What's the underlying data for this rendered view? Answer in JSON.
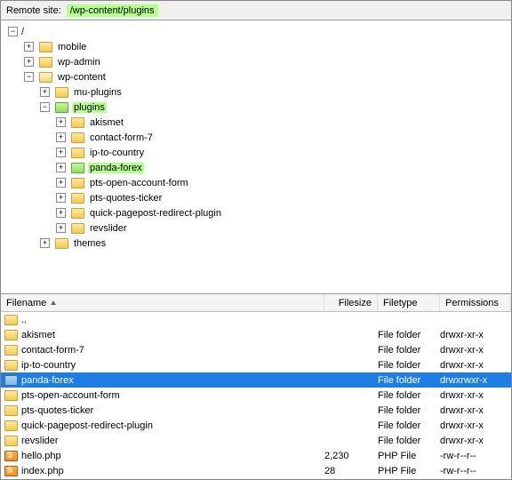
{
  "address_bar": {
    "label": "Remote site:",
    "path": "/wp-content/plugins"
  },
  "tree": [
    {
      "indent": 0,
      "tw": "c",
      "icon": "none",
      "label": "/"
    },
    {
      "indent": 1,
      "tw": "e",
      "icon": "fld",
      "label": "mobile"
    },
    {
      "indent": 1,
      "tw": "e",
      "icon": "fld",
      "label": "wp-admin"
    },
    {
      "indent": 1,
      "tw": "c",
      "icon": "fld-open",
      "label": "wp-content"
    },
    {
      "indent": 2,
      "tw": "e",
      "icon": "fld",
      "label": "mu-plugins"
    },
    {
      "indent": 2,
      "tw": "c",
      "icon": "fld-sel",
      "label": "plugins",
      "hi": true
    },
    {
      "indent": 3,
      "tw": "e",
      "icon": "fld",
      "label": "akismet"
    },
    {
      "indent": 3,
      "tw": "e",
      "icon": "fld",
      "label": "contact-form-7"
    },
    {
      "indent": 3,
      "tw": "e",
      "icon": "fld",
      "label": "ip-to-country"
    },
    {
      "indent": 3,
      "tw": "e",
      "icon": "fld-sel",
      "label": "panda-forex",
      "hi": true
    },
    {
      "indent": 3,
      "tw": "e",
      "icon": "fld",
      "label": "pts-open-account-form"
    },
    {
      "indent": 3,
      "tw": "e",
      "icon": "fld",
      "label": "pts-quotes-ticker"
    },
    {
      "indent": 3,
      "tw": "e",
      "icon": "fld",
      "label": "quick-pagepost-redirect-plugin"
    },
    {
      "indent": 3,
      "tw": "e",
      "icon": "fld",
      "label": "revslider"
    },
    {
      "indent": 2,
      "tw": "e",
      "icon": "fld",
      "label": "themes"
    }
  ],
  "columns": {
    "name": "Filename",
    "size": "Filesize",
    "type": "Filetype",
    "perm": "Permissions"
  },
  "rows": [
    {
      "icon": "fld",
      "name": "..",
      "size": "",
      "type": "",
      "perm": ""
    },
    {
      "icon": "fld",
      "name": "akismet",
      "size": "",
      "type": "File folder",
      "perm": "drwxr-xr-x"
    },
    {
      "icon": "fld",
      "name": "contact-form-7",
      "size": "",
      "type": "File folder",
      "perm": "drwxr-xr-x"
    },
    {
      "icon": "fld",
      "name": "ip-to-country",
      "size": "",
      "type": "File folder",
      "perm": "drwxr-xr-x"
    },
    {
      "icon": "fld-sel",
      "name": "panda-forex",
      "size": "",
      "type": "File folder",
      "perm": "drwxrwxr-x",
      "sel": true
    },
    {
      "icon": "fld",
      "name": "pts-open-account-form",
      "size": "",
      "type": "File folder",
      "perm": "drwxr-xr-x"
    },
    {
      "icon": "fld",
      "name": "pts-quotes-ticker",
      "size": "",
      "type": "File folder",
      "perm": "drwxr-xr-x"
    },
    {
      "icon": "fld",
      "name": "quick-pagepost-redirect-plugin",
      "size": "",
      "type": "File folder",
      "perm": "drwxr-xr-x"
    },
    {
      "icon": "fld",
      "name": "revslider",
      "size": "",
      "type": "File folder",
      "perm": "drwxr-xr-x"
    },
    {
      "icon": "php",
      "name": "hello.php",
      "size": "2,230",
      "type": "PHP File",
      "perm": "-rw-r--r--"
    },
    {
      "icon": "php",
      "name": "index.php",
      "size": "28",
      "type": "PHP File",
      "perm": "-rw-r--r--"
    }
  ]
}
